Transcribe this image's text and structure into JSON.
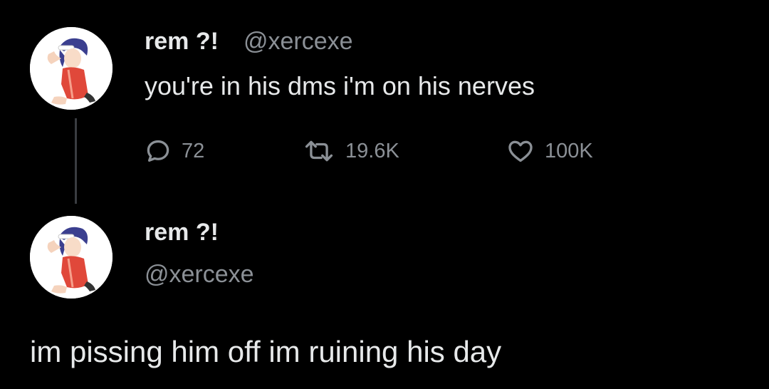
{
  "parent_tweet": {
    "display_name": "rem ?!",
    "handle": "@xercexe",
    "text": "you're in his dms i'm on his nerves",
    "avatar_icon": "anime-girl-avatar-icon",
    "actions": {
      "reply": {
        "icon": "reply-bubble-icon",
        "count": "72"
      },
      "retweet": {
        "icon": "retweet-arrows-icon",
        "count": "19.6K"
      },
      "like": {
        "icon": "heart-icon",
        "count": "100K"
      }
    }
  },
  "reply_tweet": {
    "display_name": "rem ?!",
    "handle": "@xercexe",
    "text": "im pissing him off im ruining his day",
    "avatar_icon": "anime-girl-avatar-icon"
  },
  "colors": {
    "background": "#000000",
    "primary_text": "#e7e9ea",
    "secondary_text": "#8b9096",
    "thread_line": "#3a3d41"
  }
}
